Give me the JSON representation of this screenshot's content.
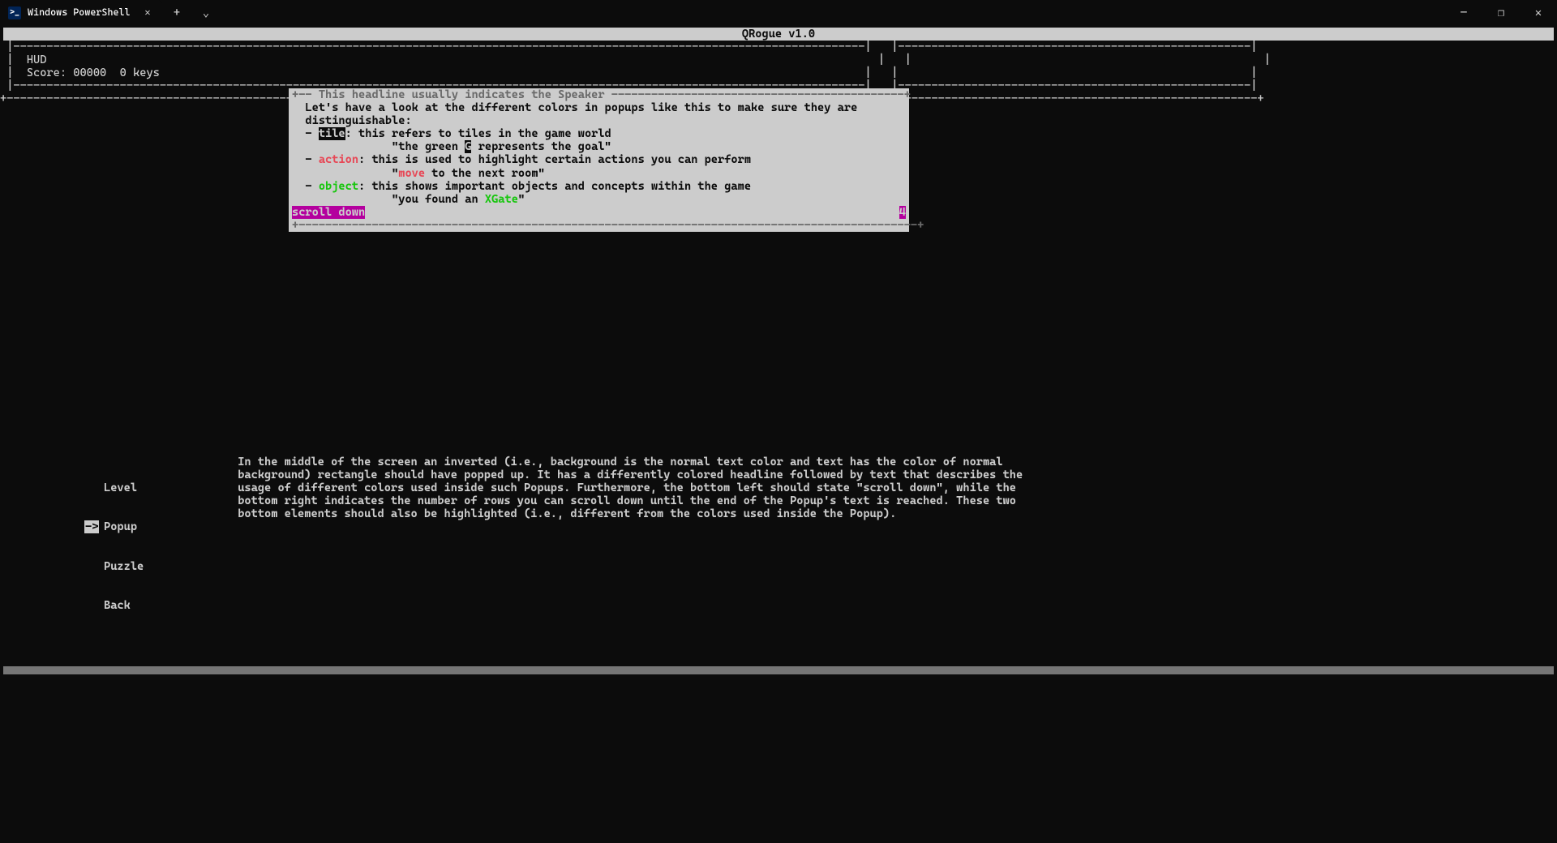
{
  "window": {
    "tab_title": "Windows PowerShell",
    "minimize_glyph": "—",
    "maximize_glyph": "❐",
    "close_glyph": "✕",
    "newtab_glyph": "+",
    "dropdown_glyph": "⌄"
  },
  "game": {
    "banner": "QRogue v1.0",
    "hud_label": "HUD",
    "score_label": "Score:",
    "score_value": "00000",
    "keys_value": "0",
    "keys_label": "keys"
  },
  "popup": {
    "headline": "This headline usually indicates the Speaker",
    "intro": "Let's have a look at the different colors in popups like this to make sure they are distinguishable:",
    "tile_label": "tile",
    "tile_text": ": this refers to tiles in the game world",
    "tile_example_pre": "\"the green ",
    "tile_example_glyph": "G",
    "tile_example_post": " represents the goal\"",
    "action_label": "action",
    "action_text": ": this is used to highlight certain actions you can perform",
    "action_example_pre": "\"",
    "action_example_word": "move",
    "action_example_post": " to the next room\"",
    "object_label": "object",
    "object_text": ": this shows important objects and concepts within the game",
    "object_example_pre": "\"you found an ",
    "object_example_word": "XGate",
    "object_example_post": "\"",
    "scroll_label": "scroll down",
    "scroll_remaining": "4"
  },
  "menu": {
    "items": [
      "Level",
      "Popup",
      "Puzzle",
      "Back"
    ],
    "selected_index": 1,
    "arrow_glyph": "->"
  },
  "description": "In the middle of the screen an inverted (i.e., background is the normal text color and text has the color of normal background) rectangle should have popped up. It has a differently colored headline followed by text that describes the usage of different colors used inside such Popups. Furthermore, the bottom left should state \"scroll down\", while the bottom right indicates the number of rows you can scroll down until the end of the Popup's text is reached. These two bottom elements should also be highlighted (i.e., different from the colors used inside the Popup)."
}
